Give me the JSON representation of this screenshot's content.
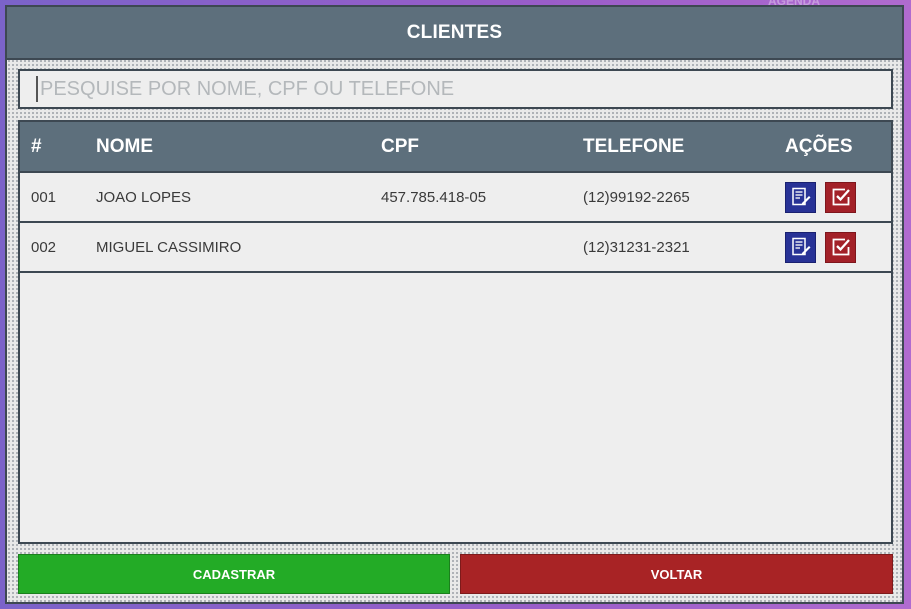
{
  "background": {
    "label": "AGENDA"
  },
  "window": {
    "title": "CLIENTES"
  },
  "search": {
    "placeholder": "PESQUISE POR NOME, CPF OU TELEFONE",
    "value": ""
  },
  "table": {
    "headers": {
      "num": "#",
      "nome": "NOME",
      "cpf": "CPF",
      "telefone": "TELEFONE",
      "acoes": "AÇÕES"
    },
    "rows": [
      {
        "num": "001",
        "nome": "JOAO LOPES",
        "cpf": "457.785.418-05",
        "telefone": "(12)99192-2265"
      },
      {
        "num": "002",
        "nome": "MIGUEL CASSIMIRO",
        "cpf": "",
        "telefone": "(12)31231-2321"
      }
    ]
  },
  "actions": {
    "cadastrar": "CADASTRAR",
    "voltar": "VOLTAR"
  },
  "icons": {
    "edit": "edit-document-icon",
    "confirm": "check-square-icon"
  },
  "colors": {
    "header": "#5d6f7c",
    "edit_button": "#283296",
    "confirm_button": "#a32128",
    "cadastrar": "#23ab26",
    "voltar": "#a82325"
  }
}
